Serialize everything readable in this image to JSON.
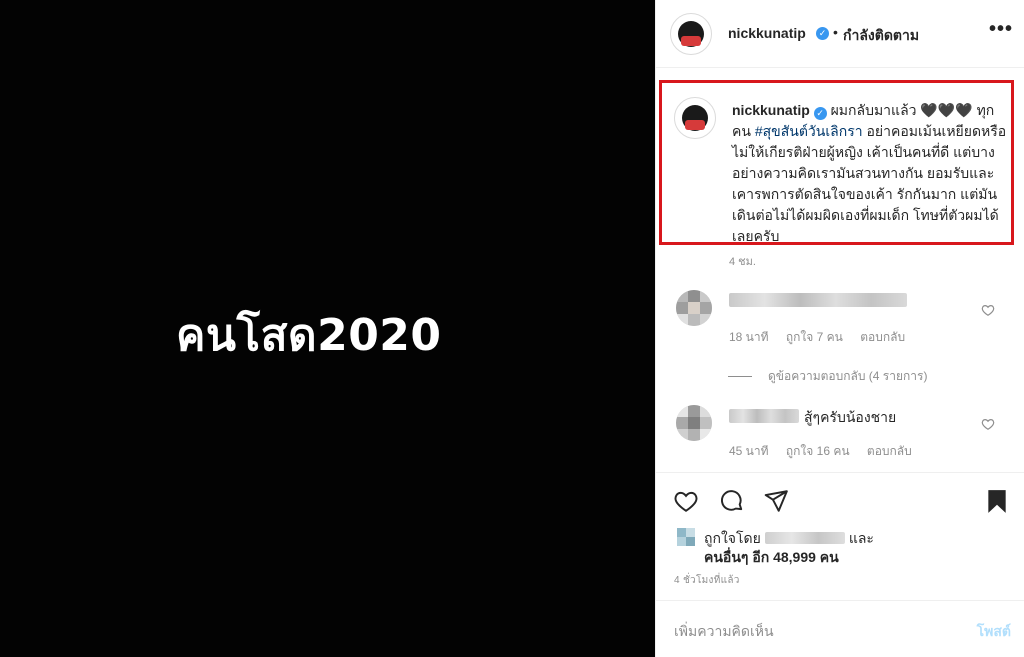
{
  "photo": {
    "text": "คนโสด2020"
  },
  "header": {
    "username": "nickkunatip",
    "dot": "•",
    "follow_status": "กำลังติดตาม",
    "more_icon": "more-horizontal-icon"
  },
  "caption": {
    "username": "nickkunatip",
    "text_start": "ผมกลับมาแล้ว 🖤🖤🖤 ทุกคน ",
    "hashtag": "#สุขสันต์วันเลิกรา",
    "text_end": " อย่าคอมเม้นเหยียดหรือไม่ให้เกียรติฝ่ายผู้หญิง เค้าเป็นคนที่ดี แต่บางอย่างความคิดเรามันสวนทางกัน ยอมรับและเคารพการตัดสินใจของเค้า รักกันมาก แต่มันเดินต่อไม่ได้ผมผิดเองที่ผมเด็ก โทษที่ตัวผมได้เลยครับ",
    "time": "4 ชม.",
    "highlight_color": "#d8171c"
  },
  "comments": [
    {
      "text": "",
      "time": "18 นาที",
      "likes": "ถูกใจ 7 คน",
      "reply": "ตอบกลับ"
    },
    {
      "text": "สู้ๆครับน้องชาย",
      "time": "45 นาที",
      "likes": "ถูกใจ 16 คน",
      "reply": "ตอบกลับ"
    }
  ],
  "view_replies": "ดูข้อความตอบกลับ (4 รายการ)",
  "likes": {
    "prefix": "ถูกใจโดย",
    "suffix": "และ",
    "others": "คนอื่นๆ อีก 48,999 คน"
  },
  "post_time": "4 ชั่วโมงที่แล้ว",
  "add_comment": {
    "placeholder": "เพิ่มความคิดเห็น",
    "post_label": "โพสต์"
  },
  "icons": [
    "heart-icon",
    "comment-icon",
    "share-icon",
    "bookmark-icon"
  ]
}
